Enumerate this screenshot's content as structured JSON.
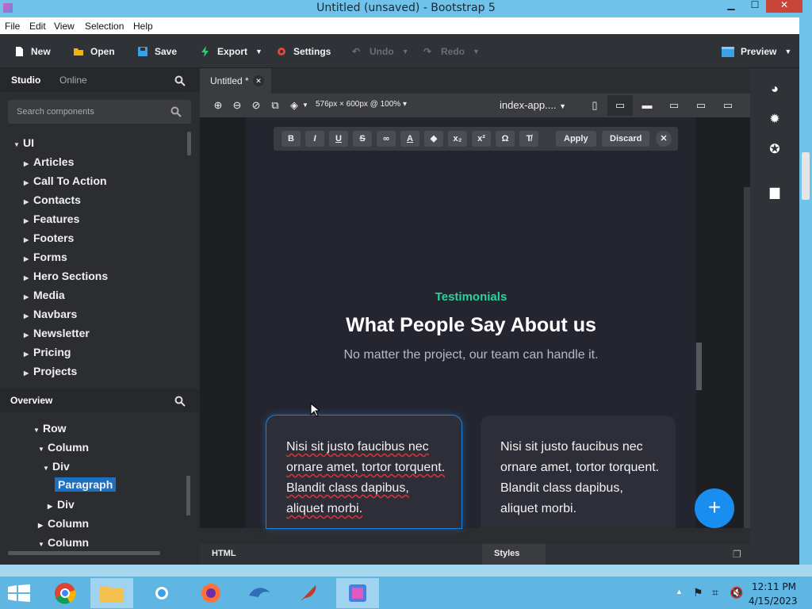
{
  "window": {
    "title": "Untitled (unsaved) - Bootstrap 5"
  },
  "menu": [
    "File",
    "Edit",
    "View",
    "Selection",
    "Help"
  ],
  "toolbar": {
    "new": "New",
    "open": "Open",
    "save": "Save",
    "export": "Export",
    "settings": "Settings",
    "undo": "Undo",
    "redo": "Redo",
    "preview": "Preview"
  },
  "left_tabs": {
    "studio": "Studio",
    "online": "Online"
  },
  "search": {
    "placeholder": "Search components"
  },
  "tree": {
    "root": "UI",
    "items": [
      "Articles",
      "Call To Action",
      "Contacts",
      "Features",
      "Footers",
      "Forms",
      "Hero Sections",
      "Media",
      "Navbars",
      "Newsletter",
      "Pricing",
      "Projects"
    ]
  },
  "overview": {
    "title": "Overview",
    "items": [
      {
        "label": "Row"
      },
      {
        "label": "Column"
      },
      {
        "label": "Div"
      },
      {
        "label": "Paragraph"
      },
      {
        "label": "Div"
      },
      {
        "label": "Column"
      },
      {
        "label": "Column"
      }
    ]
  },
  "doc_tab": {
    "label": "Untitled *"
  },
  "canvas_toolbar": {
    "size": "576px × 600px @ 100%",
    "page": "index-app...."
  },
  "inline_toolbar": {
    "apply": "Apply",
    "discard": "Discard"
  },
  "page": {
    "eyebrow": "Testimonials",
    "heading": "What People Say About us",
    "subheading": "No matter the project, our team can handle it.",
    "cards": [
      "Nisi sit justo faucibus nec ornare amet, tortor torquent. Blandit class dapibus, aliquet morbi.",
      "Nisi sit justo faucibus nec ornare amet, tortor torquent. Blandit class dapibus, aliquet morbi."
    ]
  },
  "bottom_tabs": {
    "html": "HTML",
    "styles": "Styles"
  },
  "clock": {
    "time": "12:11 PM",
    "date": "4/15/2023"
  },
  "colors": {
    "accent": "#2bd39a",
    "selection": "#1e7fd8",
    "fab": "#1a8ef0"
  }
}
